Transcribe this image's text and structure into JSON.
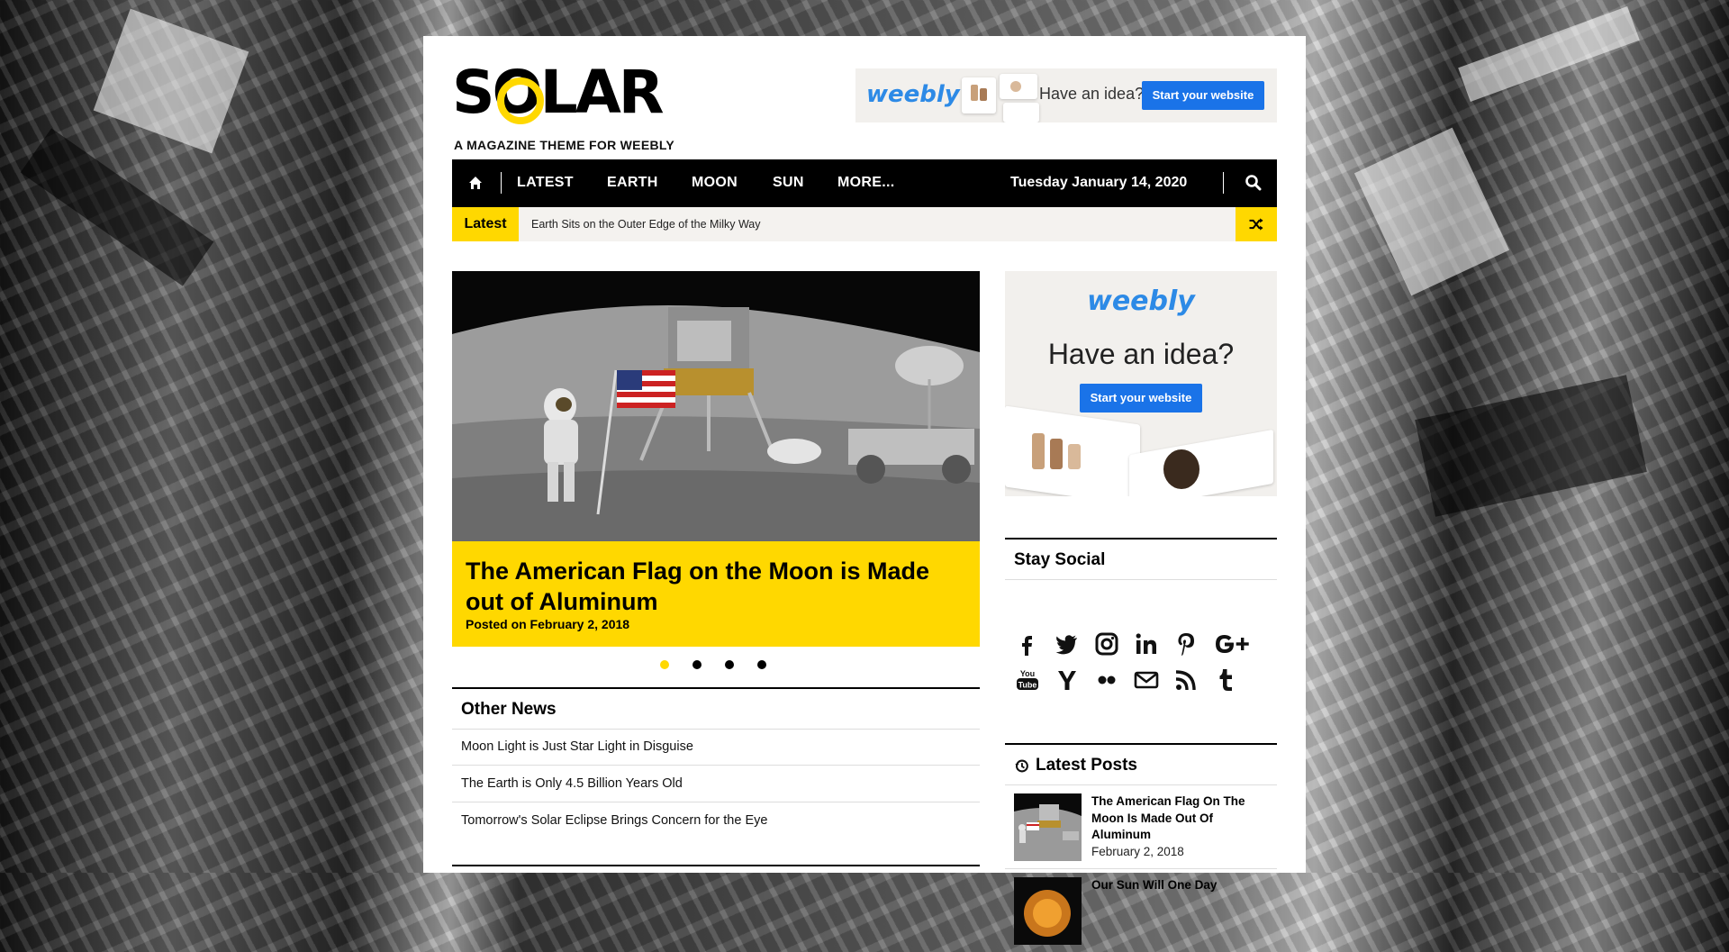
{
  "brand": {
    "name": "SOLAR",
    "tagline": "A MAGAZINE THEME FOR WEEBLY",
    "accent": "#ffd800"
  },
  "ads": {
    "logo": "weebly",
    "headline": "Have an idea?",
    "cta": "Start your website"
  },
  "nav": {
    "items": [
      "LATEST",
      "EARTH",
      "MOON",
      "SUN",
      "MORE..."
    ],
    "date": "Tuesday January 14, 2020",
    "home_icon": "home-icon",
    "search_icon": "search-icon"
  },
  "ticker": {
    "label": "Latest",
    "headline": "Earth Sits on the Outer Edge of the Milky Way",
    "shuffle_icon": "shuffle-icon"
  },
  "slider": {
    "title": "The American Flag on the Moon is Made out of Aluminum",
    "date": "Posted on February 2, 2018",
    "slide_count": 4,
    "active_index": 0
  },
  "other_news": {
    "heading": "Other News",
    "items": [
      "Moon Light is Just Star Light in Disguise",
      "The Earth is Only 4.5 Billion Years Old",
      "Tomorrow's Solar Eclipse Brings Concern for the Eye"
    ]
  },
  "stay_social": {
    "heading": "Stay Social",
    "icons": [
      "facebook-icon",
      "twitter-icon",
      "instagram-icon",
      "linkedin-icon",
      "pinterest-icon",
      "google-plus-icon",
      "youtube-icon",
      "yahoo-icon",
      "flickr-icon",
      "email-icon",
      "rss-icon",
      "tumblr-icon"
    ]
  },
  "latest_posts": {
    "heading": "Latest Posts",
    "items": [
      {
        "title": "The American Flag On The Moon Is Made Out Of Aluminum",
        "date": "February 2, 2018"
      },
      {
        "title": "Our Sun Will One Day",
        "date": ""
      }
    ]
  }
}
